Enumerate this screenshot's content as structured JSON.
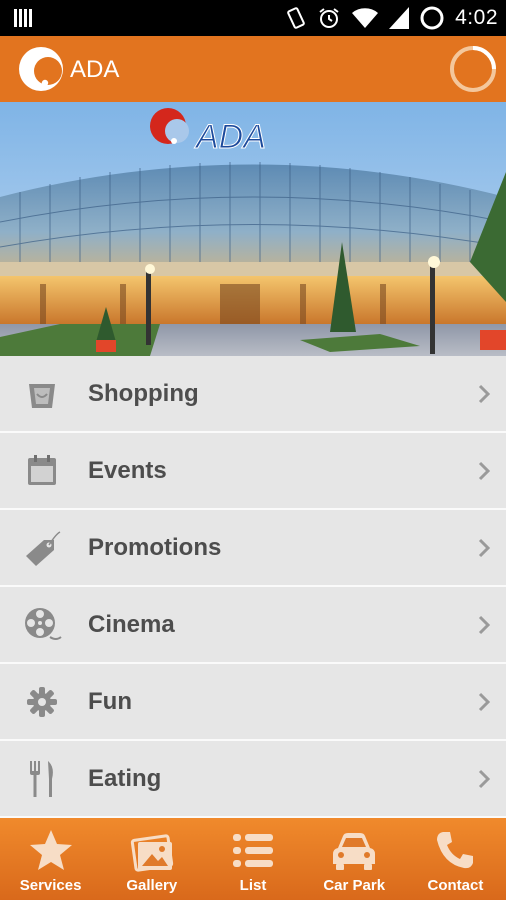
{
  "status_bar": {
    "time": "4:02"
  },
  "app_bar": {
    "title": "ADA"
  },
  "hero": {
    "sign_text": "ADA"
  },
  "menu": [
    {
      "label": "Shopping",
      "icon": "shopping-bag-icon"
    },
    {
      "label": "Events",
      "icon": "calendar-icon"
    },
    {
      "label": "Promotions",
      "icon": "tag-icon"
    },
    {
      "label": "Cinema",
      "icon": "film-reel-icon"
    },
    {
      "label": "Fun",
      "icon": "gear-icon"
    },
    {
      "label": "Eating",
      "icon": "fork-knife-icon"
    }
  ],
  "tabs": [
    {
      "label": "Services",
      "icon": "star-icon"
    },
    {
      "label": "Gallery",
      "icon": "gallery-icon"
    },
    {
      "label": "List",
      "icon": "list-icon"
    },
    {
      "label": "Car Park",
      "icon": "car-icon"
    },
    {
      "label": "Contact",
      "icon": "phone-icon"
    }
  ],
  "colors": {
    "accent": "#e2741f",
    "menu_bg": "#e6e6e6",
    "menu_text": "#4d4d4d"
  }
}
